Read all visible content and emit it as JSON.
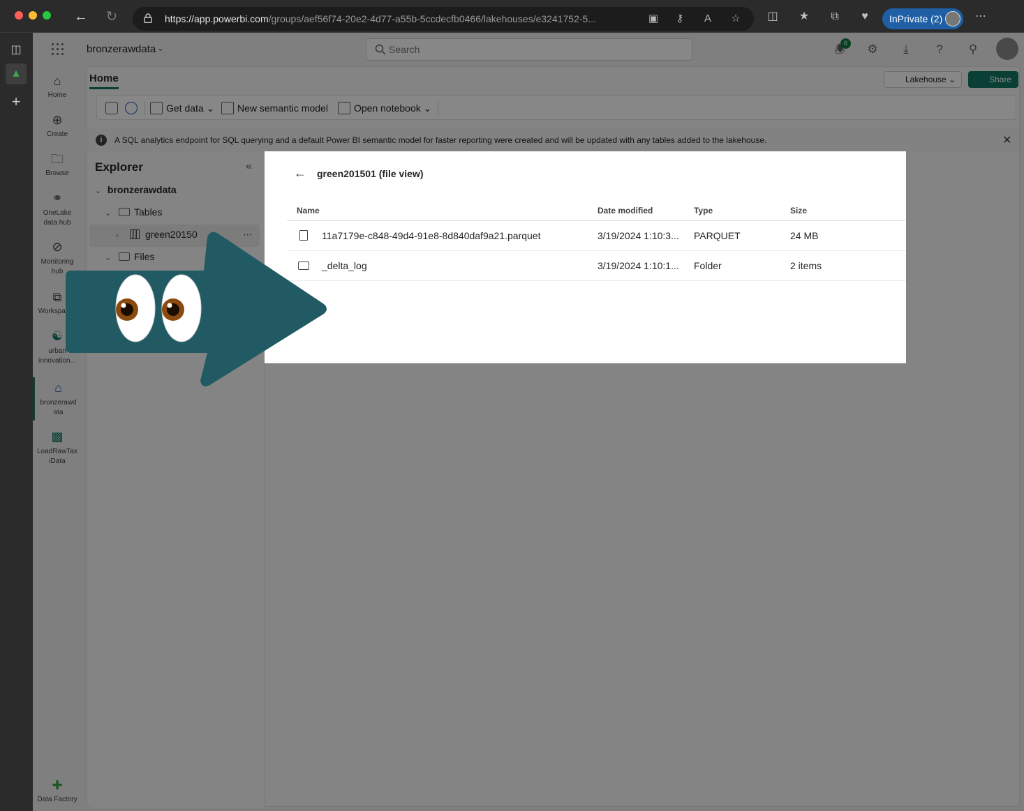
{
  "browser": {
    "url_host": "https://app.powerbi.com",
    "url_path": "/groups/aef56f74-20e2-4d77-a55b-5ccdecfb0466/lakehouses/e3241752-5...",
    "inprivate_label": "InPrivate (2)"
  },
  "topbar": {
    "workspace_name": "bronzerawdata",
    "search_placeholder": "Search",
    "notification_count": "6"
  },
  "appnav": {
    "items": [
      {
        "label": "Home",
        "icon": "home-icon"
      },
      {
        "label": "Create",
        "icon": "plus-circle-icon"
      },
      {
        "label": "Browse",
        "icon": "folder-icon"
      },
      {
        "label": "OneLake data hub",
        "icon": "onelake-icon"
      },
      {
        "label": "Monitoring hub",
        "icon": "monitor-icon"
      },
      {
        "label": "Workspaces",
        "icon": "workspaces-icon"
      },
      {
        "label": "urban innovation...",
        "icon": "people-icon"
      },
      {
        "label": "bronzerawdata",
        "icon": "lakehouse-icon"
      },
      {
        "label": "LoadRawTaxiData",
        "icon": "pipeline-icon"
      }
    ],
    "footer_label": "Data Factory"
  },
  "content": {
    "home_tab": "Home",
    "lakehouse_label": "Lakehouse",
    "share_label": "Share",
    "ribbon": {
      "get_data": "Get data",
      "new_semantic_model": "New semantic model",
      "open_notebook": "Open notebook"
    },
    "info_message": "A SQL analytics endpoint for SQL querying and a default Power BI semantic model for faster reporting were created and will be updated with any tables added to the lakehouse."
  },
  "explorer": {
    "title": "Explorer",
    "root": "bronzerawdata",
    "tables": "Tables",
    "table_item": "green20150",
    "files": "Files"
  },
  "dialog": {
    "title": "green201501 (file view)",
    "columns": {
      "name": "Name",
      "date": "Date modified",
      "type": "Type",
      "size": "Size"
    },
    "rows": [
      {
        "name": "11a7179e-c848-49d4-91e8-8d840daf9a21.parquet",
        "date": "3/19/2024 1:10:3...",
        "type": "PARQUET",
        "size": "24 MB",
        "icon": "file-icon"
      },
      {
        "name": "_delta_log",
        "date": "3/19/2024 1:10:1...",
        "type": "Folder",
        "size": "2 items",
        "icon": "folder-icon"
      }
    ]
  },
  "colors": {
    "accent": "#117865",
    "arrow": "#225a63",
    "overlay": "rgba(0,0,0,0.47)"
  }
}
